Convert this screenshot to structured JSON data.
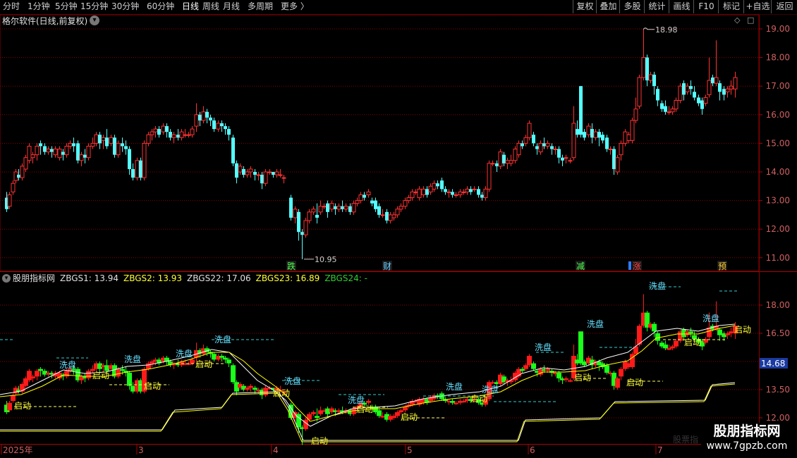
{
  "toolbar": {
    "periods": [
      {
        "label": "分时"
      },
      {
        "label": "1分钟"
      },
      {
        "label": "5分钟"
      },
      {
        "label": "15分钟"
      },
      {
        "label": "30分钟"
      },
      {
        "label": "60分钟"
      },
      {
        "label": "日线",
        "active": true
      },
      {
        "label": "周线"
      },
      {
        "label": "月线"
      },
      {
        "label": "多周期"
      },
      {
        "label": "更多 〉"
      }
    ],
    "right_buttons": [
      "复权",
      "叠加",
      "多股",
      "统计",
      "画线",
      "F10",
      "标记",
      "+自选",
      "返回"
    ]
  },
  "main_panel": {
    "title": "格尔软件(日线,前复权)",
    "y_ticks": [
      "19.00",
      "18.00",
      "17.00",
      "16.00",
      "15.00",
      "14.00",
      "13.00",
      "12.00",
      "11.00"
    ],
    "high_label": "18.98",
    "low_label": "10.95",
    "event_markers": [
      {
        "text": "跌",
        "color": "#4cff4c"
      },
      {
        "text": "财",
        "color": "#66ccff"
      },
      {
        "text": "减",
        "color": "#4cff4c"
      },
      {
        "text": "涨",
        "color": "#ff4040"
      },
      {
        "text": "预",
        "color": "#ffcc33"
      }
    ]
  },
  "indicator_panel": {
    "name": "股朋指标网",
    "values": [
      {
        "label": "ZBGS1: 13.94",
        "color": "#e0e0e0"
      },
      {
        "label": "ZBGS2: 13.93",
        "color": "#ffff33"
      },
      {
        "label": "ZBGS22: 17.06",
        "color": "#e0e0e0"
      },
      {
        "label": "ZBGS23: 16.89",
        "color": "#ffff33"
      },
      {
        "label": "ZBGS24: -",
        "color": "#33cc33"
      }
    ],
    "y_ticks": [
      "18.00",
      "16.50",
      "13.50",
      "12.00"
    ],
    "current_price": "14.68",
    "signal_wash": "洗盘",
    "signal_start": "启动"
  },
  "date_axis": {
    "labels": [
      "2025年",
      "3",
      "4",
      "5",
      "6",
      "7"
    ]
  },
  "watermark_text": "股票指",
  "brand": {
    "title": "股朋指标网",
    "url": "www.7gpzb.com"
  },
  "colors": {
    "up": "#ff3232",
    "down": "#54ffff",
    "grid": "#8b0000",
    "ma_white": "#ffffff",
    "ma_yellow": "#ffff00"
  },
  "chart_data": {
    "type": "candlestick",
    "period": "daily",
    "adjust": "forward",
    "y_range": [
      10.8,
      19.3
    ],
    "high": 18.98,
    "low": 10.95,
    "x_labels": [
      "2025年",
      "3",
      "4",
      "5",
      "6",
      "7"
    ]
  }
}
